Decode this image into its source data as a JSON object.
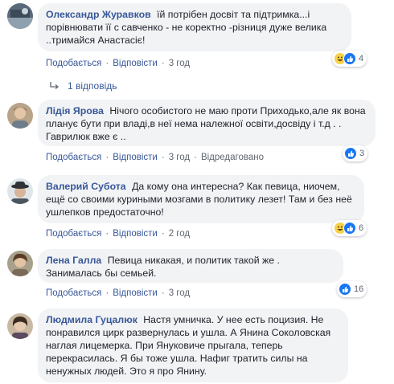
{
  "ui": {
    "like_label": "Подобається",
    "reply_label": "Відповісти",
    "edited_label": "Відредаговано"
  },
  "comments": [
    {
      "author": "Олександр Журавков",
      "text": "їй потрібен досвіт та підтримка...і порівнювати її с савченко - не коректно -різниця дуже велика ..тримайся Анастасіє!",
      "time": "3 год",
      "reaction_count": "4",
      "reaction_icons": [
        "haha-icon",
        "like-icon"
      ]
    },
    {
      "author": "Лідія Ярова",
      "text": "Нічого особистого не маю проти Приходько,але як вона планує бути при владі,в неї нема належної освіти,досвіду і т.д . . Гаврилюк вже є ..",
      "time": "3 год",
      "reaction_count": "3",
      "reaction_icons": [
        "like-icon"
      ]
    },
    {
      "author": "Валерий Субота",
      "text": "Да кому она интересна? Как певица, ниочем, ещё со своими куриными мозгами в политику лезет! Там и без неё ушлепков предостаточно!",
      "time": "2 год",
      "reaction_count": "6",
      "reaction_icons": [
        "haha-icon",
        "like-icon"
      ]
    },
    {
      "author": "Лена Галла",
      "text": "Певица никакая, и политик такой же . Занималась бы семьей.",
      "time": "3 год",
      "reaction_count": "16",
      "reaction_icons": [
        "like-icon"
      ]
    },
    {
      "author": "Людмила Гуцалюк",
      "text": "Настя умничка. У нее есть поцизия. Не понравился цирк развернулась и ушла. А Янина Соколовская наглая лицемерка. При Януковиче прыгала, теперь перекрасилась. Я бы тоже ушла. Нафиг тратить силы на ненужных людей. Это я про Янину."
    }
  ],
  "replies": {
    "label": "1 відповідь"
  },
  "colors": {
    "link": "#385898",
    "bubble": "#f2f3f5",
    "meta": "#606770",
    "like": "#1877f2"
  }
}
